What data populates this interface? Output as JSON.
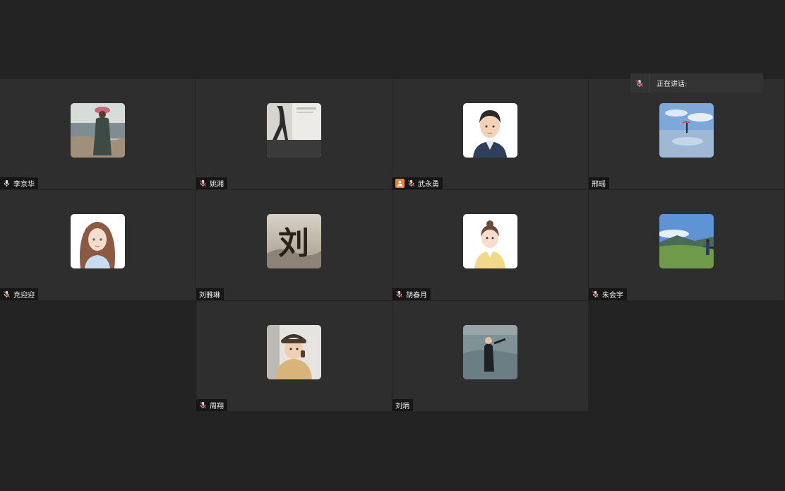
{
  "speaking_indicator": {
    "label": "正在讲话:"
  },
  "participants": [
    {
      "name": "李京华",
      "mic": "on"
    },
    {
      "name": "姚湘",
      "mic": "muted"
    },
    {
      "name": "武永勇",
      "mic": "muted",
      "host_badge": true
    },
    {
      "name": "邢瑶",
      "mic": "none"
    },
    {
      "name": "克迎迎",
      "mic": "muted"
    },
    {
      "name": "刘雅琳",
      "mic": "none"
    },
    {
      "name": "胡春月",
      "mic": "muted"
    },
    {
      "name": "朱会宇",
      "mic": "muted"
    },
    {
      "name": "周翔",
      "mic": "muted"
    },
    {
      "name": "刘炳",
      "mic": "none"
    }
  ],
  "avatar_art": {
    "calligraphy_char": "刘"
  },
  "colors": {
    "host_badge": "#e0883a",
    "mute_slash": "#e04a4a",
    "tile_bg": "#2e2e2e",
    "page_bg": "#232323"
  }
}
